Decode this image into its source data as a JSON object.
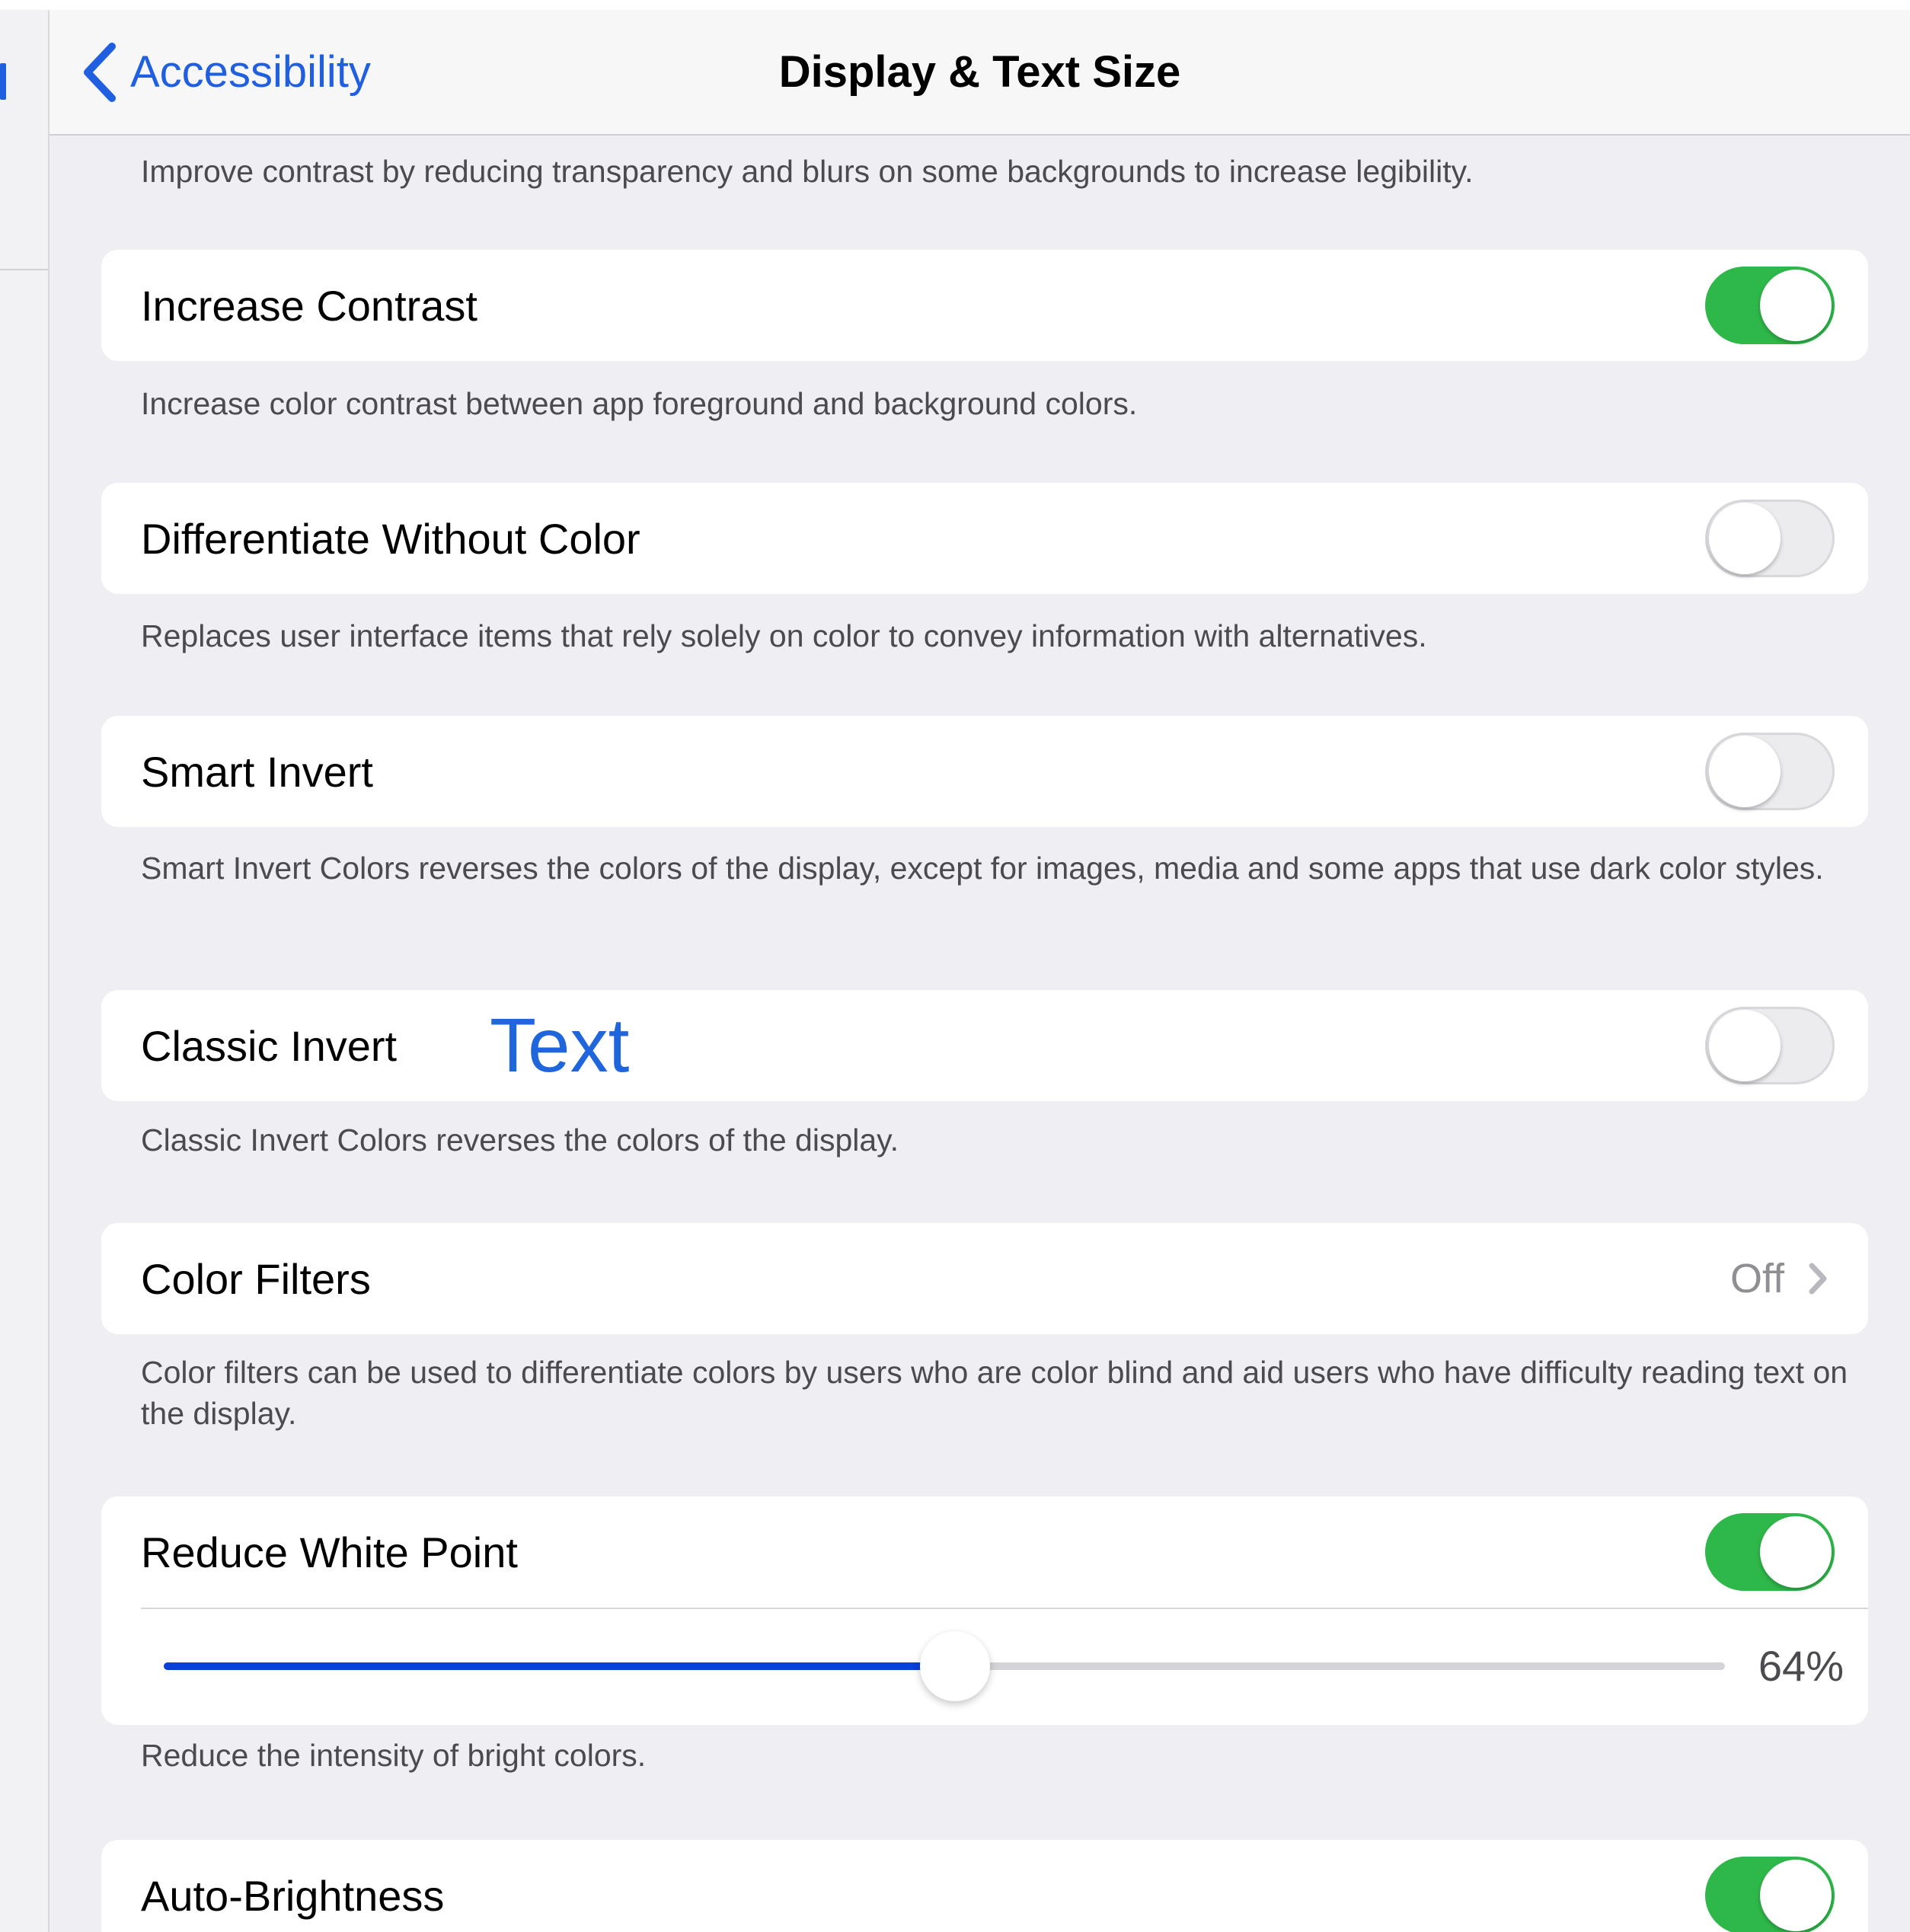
{
  "nav": {
    "back_label": "Accessibility",
    "title": "Display & Text Size"
  },
  "top_footer": "Improve contrast by reducing transparency and blurs on some backgrounds to increase legibility.",
  "settings": {
    "increase_contrast": {
      "label": "Increase Contrast",
      "toggle": "on",
      "footer": "Increase color contrast between app foreground and background colors."
    },
    "differentiate_without_color": {
      "label": "Differentiate Without Color",
      "toggle": "off",
      "footer": "Replaces user interface items that rely solely on color to convey information with alternatives."
    },
    "smart_invert": {
      "label": "Smart Invert",
      "toggle": "off",
      "footer": "Smart Invert Colors reverses the colors of the display, except for images, media and some apps that use dark color styles."
    },
    "classic_invert": {
      "label": "Classic Invert",
      "overlay_text": "Text",
      "toggle": "off",
      "footer": "Classic Invert Colors reverses the colors of the display."
    },
    "color_filters": {
      "label": "Color Filters",
      "value": "Off",
      "footer": "Color filters can be used to differentiate colors by users who are color blind and aid users who have difficulty reading text on the display."
    },
    "reduce_white_point": {
      "label": "Reduce White Point",
      "toggle": "on",
      "slider_percent": 64,
      "slider_value_text": "64%",
      "footer": "Reduce the intensity of bright colors."
    },
    "auto_brightness": {
      "label": "Auto-Brightness",
      "toggle": "on"
    }
  },
  "colors": {
    "accent": "#1f5fe0",
    "toggle_on": "#2fb84a",
    "slider_fill": "#0a3fd8",
    "background": "#eeeef3"
  },
  "icons": {
    "back": "chevron-left-icon",
    "disclosure": "chevron-right-icon"
  }
}
